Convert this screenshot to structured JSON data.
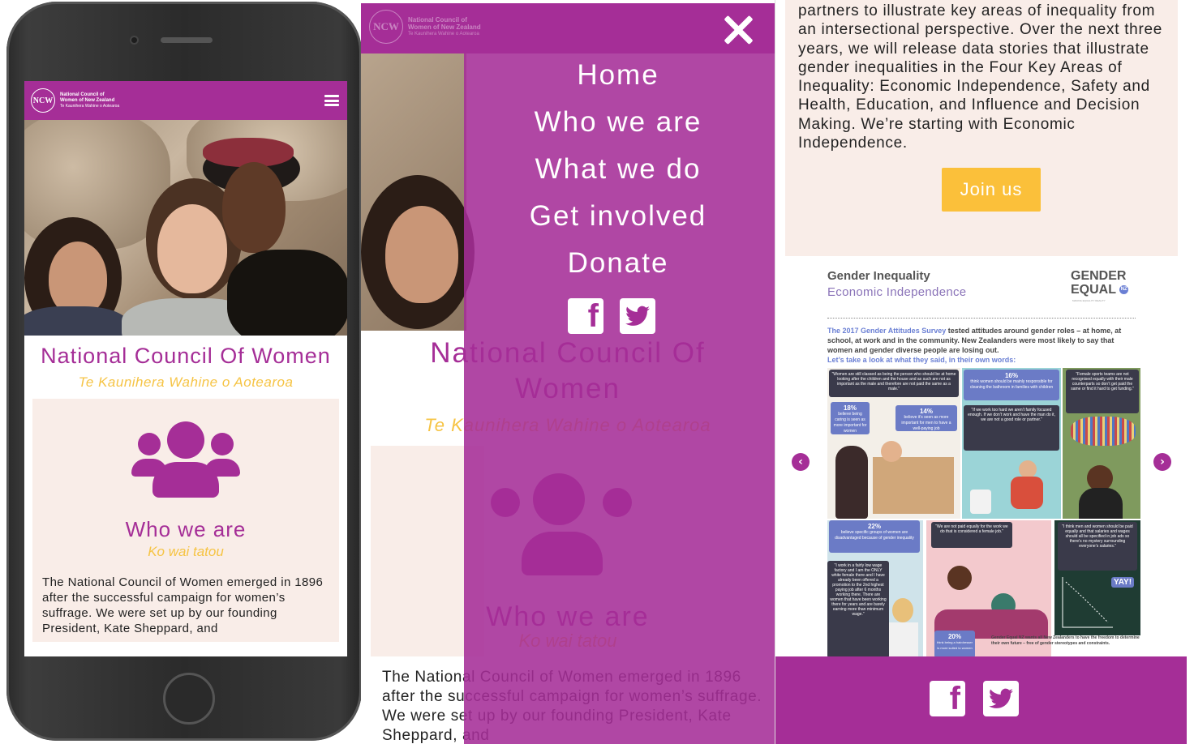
{
  "brand": {
    "logo_mark": "NCW",
    "logo_line1": "National Council of",
    "logo_line2": "Women of New Zealand",
    "logo_line3": "Te Kaunihera Wahine o Aotearoa",
    "color_primary": "#a52e97",
    "color_accent": "#f6c445",
    "color_button": "#fbc03a",
    "color_card": "#f9ede8"
  },
  "mobile": {
    "menu_icon": "hamburger-icon",
    "title": "National Council Of Women",
    "tagline": "Te Kaunihera Wahine o Aotearoa",
    "section_icon": "people-group-icon",
    "section_title": "Who we are",
    "section_subtitle": "Ko wai tatou",
    "section_body": "The National Council of Women emerged in 1896 after the successful campaign for women’s suffrage. We were set up by our founding President, Kate Sheppard, and"
  },
  "menu_overlay": {
    "close_icon": "close-icon",
    "items": [
      "Home",
      "Who we are",
      "What we do",
      "Get involved",
      "Donate"
    ],
    "social": [
      "facebook-icon",
      "twitter-icon"
    ]
  },
  "panel2_background": {
    "title_line1": "National Council Of",
    "title_line2": "Women",
    "tagline": "Te Kaunihera Wahine o Aotearoa",
    "section_title": "Who we are",
    "section_subtitle": "Ko wai tatou",
    "body": "The National Council of Women emerged in 1896 after the successful campaign for women’s suffrage. We were set up by our founding President, Kate Sheppard, and"
  },
  "desktop": {
    "paragraph": "partners to illustrate key areas of inequality from an intersectional perspective. Over the next three years, we will release data stories that illustrate gender inequalities in the Four Key Areas of Inequality: Economic Independence, Safety and Health, Education, and Influence and Decision Making. We’re starting with Economic Independence.",
    "join_button": "Join us",
    "carousel": {
      "prev_icon": "arrow-left-icon",
      "next_icon": "arrow-right-icon",
      "infographic_title": "Gender Inequality",
      "infographic_subtitle": "Economic Independence",
      "brand_line1": "GENDER",
      "brand_line2": "EQUAL",
      "brand_nz": "NZ",
      "brand_tagline": "MAKING EQUALITY REALITY",
      "intro_link": "The 2017 Gender Attitudes Survey",
      "intro_text": " tested attitudes around gender roles – at home, at school, at work and in the community. New Zealanders were most likely to say that women and gender diverse people are losing out.",
      "intro_cta": "Let’s take a look at what they said, in their own words:",
      "stats": [
        {
          "value": "16%",
          "text": "think women should be mainly responsible for cleaning the bathroom in families with children"
        },
        {
          "value": "18%",
          "text": "believe being caring is seen as more important for women"
        },
        {
          "value": "14%",
          "text": "believe it’s seen as more important for men to have a well-paying job"
        },
        {
          "value": "22%",
          "text": "believe specific groups of women are disadvantaged because of gender inequality"
        },
        {
          "value": "20%",
          "text": "think being a hairdresser is more suited to women"
        }
      ],
      "quotes": [
        "“Women are still classed as being the person who should be at home looking after the children and the house and as such are not as important as the male and therefore are not paid the same as a male.”",
        "“Female sports teams are not recognised equally with their male counterparts so don’t get paid the same or find it hard to get funding.”",
        "“If we work too hard we aren’t family focused enough. If we don’t work and have the man do it, we are not a good role or partner.”",
        "“We are not paid equally for the work we do that is considered a female job.”",
        "“I think men and women should be paid equally and that salaries and wages should all be specified in job ads so there’s no mystery surrounding everyone’s salaries.”",
        "“I work in a fairly low wage factory and I am the ONLY white female there and I have already been offered a promotion to the 2nd highest paying job after 6 months working there. There are women that have been working there for years and are barely earning more than minimum wage.”"
      ],
      "yay": "YAY!",
      "footer_note": "Gender Equal NZ wants all New Zealanders to have the freedom to determine their own future – free of gender stereotypes and constraints."
    },
    "footer_social": [
      "facebook-icon",
      "twitter-icon"
    ]
  }
}
